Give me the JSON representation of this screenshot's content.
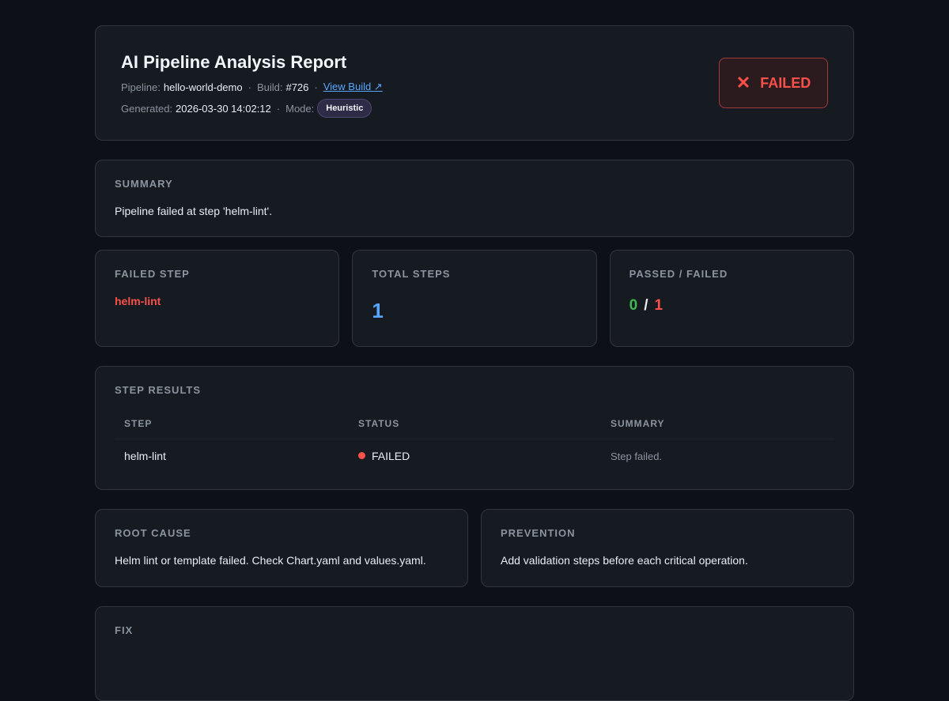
{
  "header": {
    "title": "AI Pipeline Analysis Report",
    "pipeline_label": "Pipeline:",
    "pipeline_value": "hello-world-demo",
    "build_label": "Build:",
    "build_value": "#726",
    "view_build_link": "View Build ↗",
    "generated_label": "Generated:",
    "generated_value": "2026-03-30 14:02:12",
    "mode_label": "Mode:",
    "mode_value": "Heuristic",
    "status": "FAILED",
    "status_icon": "✕"
  },
  "summary": {
    "title": "SUMMARY",
    "text": "Pipeline failed at step 'helm-lint'."
  },
  "stats": {
    "failed_step_title": "FAILED STEP",
    "failed_step_value": "helm-lint",
    "total_steps_title": "TOTAL STEPS",
    "total_steps_value": "1",
    "passed_failed_title": "PASSED / FAILED",
    "passed_value": "0",
    "slash": "/",
    "failed_value": "1"
  },
  "step_results": {
    "title": "STEP RESULTS",
    "columns": [
      "STEP",
      "STATUS",
      "SUMMARY"
    ],
    "rows": [
      {
        "step": "helm-lint",
        "status": "FAILED",
        "summary": "Step failed."
      }
    ]
  },
  "root_cause": {
    "title": "ROOT CAUSE",
    "text": "Helm lint or template failed. Check Chart.yaml and values.yaml."
  },
  "prevention": {
    "title": "PREVENTION",
    "text": "Add validation steps before each critical operation."
  },
  "fix": {
    "title": "FIX"
  },
  "colors": {
    "background": "#0d1117",
    "card": "#161b22",
    "fail": "#f85149",
    "pass": "#3fb950",
    "accent": "#58a6ff"
  }
}
